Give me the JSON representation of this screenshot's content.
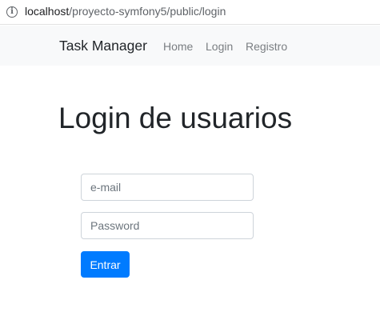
{
  "browser": {
    "url_host": "localhost",
    "url_path": "/proyecto-symfony5/public/login",
    "info_icon": "info-circle-icon"
  },
  "navbar": {
    "brand": "Task Manager",
    "links": [
      "Home",
      "Login",
      "Registro"
    ]
  },
  "page": {
    "title": "Login de usuarios"
  },
  "form": {
    "email_placeholder": "e-mail",
    "password_placeholder": "Password",
    "submit_label": "Entrar"
  },
  "colors": {
    "primary": "#007bff",
    "navbar_bg": "#f8f9fa",
    "text": "#212529",
    "nav_link": "#7a7e82"
  }
}
